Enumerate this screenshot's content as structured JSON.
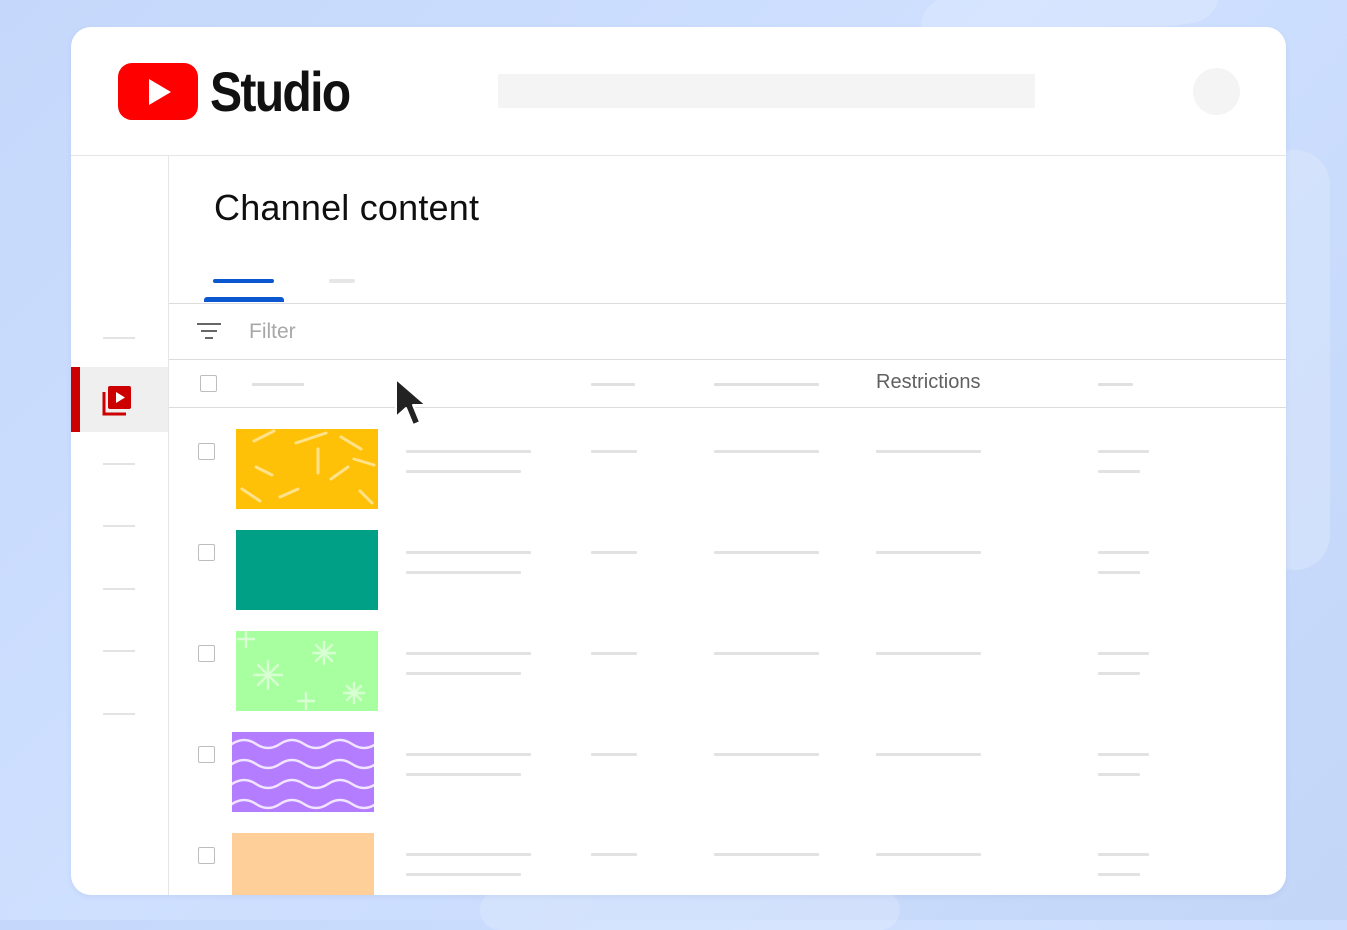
{
  "app": {
    "name": "Studio",
    "logo_icon": "youtube-play-icon"
  },
  "header": {
    "search_placeholder": "",
    "avatar_icon": "account-avatar"
  },
  "sidebar": {
    "active_item_icon": "channel-content-icon",
    "accent_color": "#cc0000"
  },
  "main": {
    "title": "Channel content",
    "tabs": [
      {
        "label": "",
        "active": true
      },
      {
        "label": "",
        "active": false
      }
    ],
    "filter": {
      "placeholder": "Filter",
      "icon": "filter-icon"
    },
    "table": {
      "columns": [
        "",
        "",
        "",
        "Restrictions",
        ""
      ],
      "rows": [
        {
          "thumbnail_color": "#ffc107",
          "pattern": "dashes"
        },
        {
          "thumbnail_color": "#00a086",
          "pattern": "none"
        },
        {
          "thumbnail_color": "#a7ff9f",
          "pattern": "stars"
        },
        {
          "thumbnail_color": "#b47cff",
          "pattern": "waves"
        },
        {
          "thumbnail_color": "#ffcf99",
          "pattern": "none"
        }
      ]
    }
  },
  "colors": {
    "brand_red": "#ff0000",
    "tab_blue": "#0b57d0",
    "background": "#c5d8fb"
  }
}
